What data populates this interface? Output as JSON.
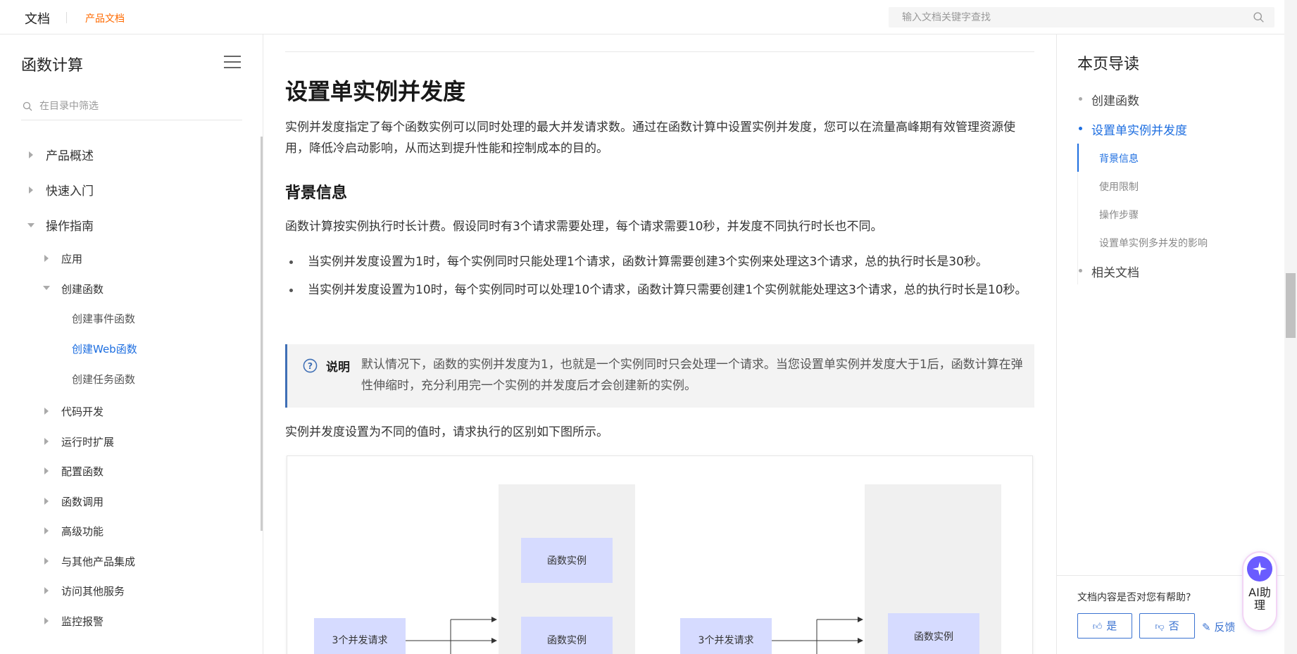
{
  "header": {
    "brand": "文档",
    "product_link": "产品文档",
    "search_placeholder": "输入文档关键字查找",
    "search_icon": "search-icon"
  },
  "sidebar": {
    "title": "函数计算",
    "filter_placeholder": "在目录中筛选",
    "items": [
      {
        "label": "产品概述",
        "level": 1,
        "state": "collapsed"
      },
      {
        "label": "快速入门",
        "level": 1,
        "state": "collapsed"
      },
      {
        "label": "操作指南",
        "level": 1,
        "state": "expanded"
      },
      {
        "label": "应用",
        "level": 2,
        "state": "collapsed"
      },
      {
        "label": "创建函数",
        "level": 2,
        "state": "expanded"
      },
      {
        "label": "创建事件函数",
        "level": 3
      },
      {
        "label": "创建Web函数",
        "level": 3,
        "active": true
      },
      {
        "label": "创建任务函数",
        "level": 3
      },
      {
        "label": "代码开发",
        "level": 2,
        "state": "collapsed"
      },
      {
        "label": "运行时扩展",
        "level": 2,
        "state": "collapsed"
      },
      {
        "label": "配置函数",
        "level": 2,
        "state": "collapsed"
      },
      {
        "label": "函数调用",
        "level": 2,
        "state": "collapsed"
      },
      {
        "label": "高级功能",
        "level": 2,
        "state": "collapsed"
      },
      {
        "label": "与其他产品集成",
        "level": 2,
        "state": "collapsed"
      },
      {
        "label": "访问其他服务",
        "level": 2,
        "state": "collapsed"
      },
      {
        "label": "监控报警",
        "level": 2,
        "state": "collapsed"
      }
    ]
  },
  "main": {
    "title": "设置单实例并发度",
    "intro": "实例并发度指定了每个函数实例可以同时处理的最大并发请求数。通过在函数计算中设置实例并发度，您可以在流量高峰期有效管理资源使用，降低冷启动影响，从而达到提升性能和控制成本的目的。",
    "section_title": "背景信息",
    "section_para": "函数计算按实例执行时长计费。假设同时有3个请求需要处理，每个请求需要10秒，并发度不同执行时长也不同。",
    "bullets": [
      "当实例并发度设置为1时，每个实例同时只能处理1个请求，函数计算需要创建3个实例来处理这3个请求，总的执行时长是30秒。",
      "当实例并发度设置为10时，每个实例同时可以处理10个请求，函数计算只需要创建1个实例就能处理这3个请求，总的执行时长是10秒。"
    ],
    "note_label": "说明",
    "note_text": "默认情况下，函数的实例并发度为1，也就是一个实例同时只会处理一个请求。当您设置单实例并发度大于1后，函数计算在弹性伸缩时，充分利用完一个实例的并发度后才会创建新的实例。",
    "figure_caption": "实例并发度设置为不同的值时，请求执行的区别如下图所示。",
    "figure": {
      "request_label": "3个并发请求",
      "instance_label": "函数实例"
    }
  },
  "toc": {
    "title": "本页导读",
    "items": [
      {
        "label": "创建函数"
      },
      {
        "label": "设置单实例并发度",
        "active": true
      },
      {
        "label": "相关文档"
      }
    ],
    "subitems": [
      {
        "label": "背景信息",
        "active": true
      },
      {
        "label": "使用限制"
      },
      {
        "label": "操作步骤"
      },
      {
        "label": "设置单实例多并发的影响"
      }
    ]
  },
  "feedback": {
    "question": "文档内容是否对您有帮助?",
    "yes": "是",
    "no": "否",
    "report": "反馈"
  },
  "assistant": {
    "label": "AI助理"
  },
  "colors": {
    "accent": "#1d6ee0",
    "brand_orange": "#ff6a00",
    "note_border": "#3f6fb5",
    "figure_box": "#d6dbff",
    "figure_panel": "#f0f0f0"
  }
}
